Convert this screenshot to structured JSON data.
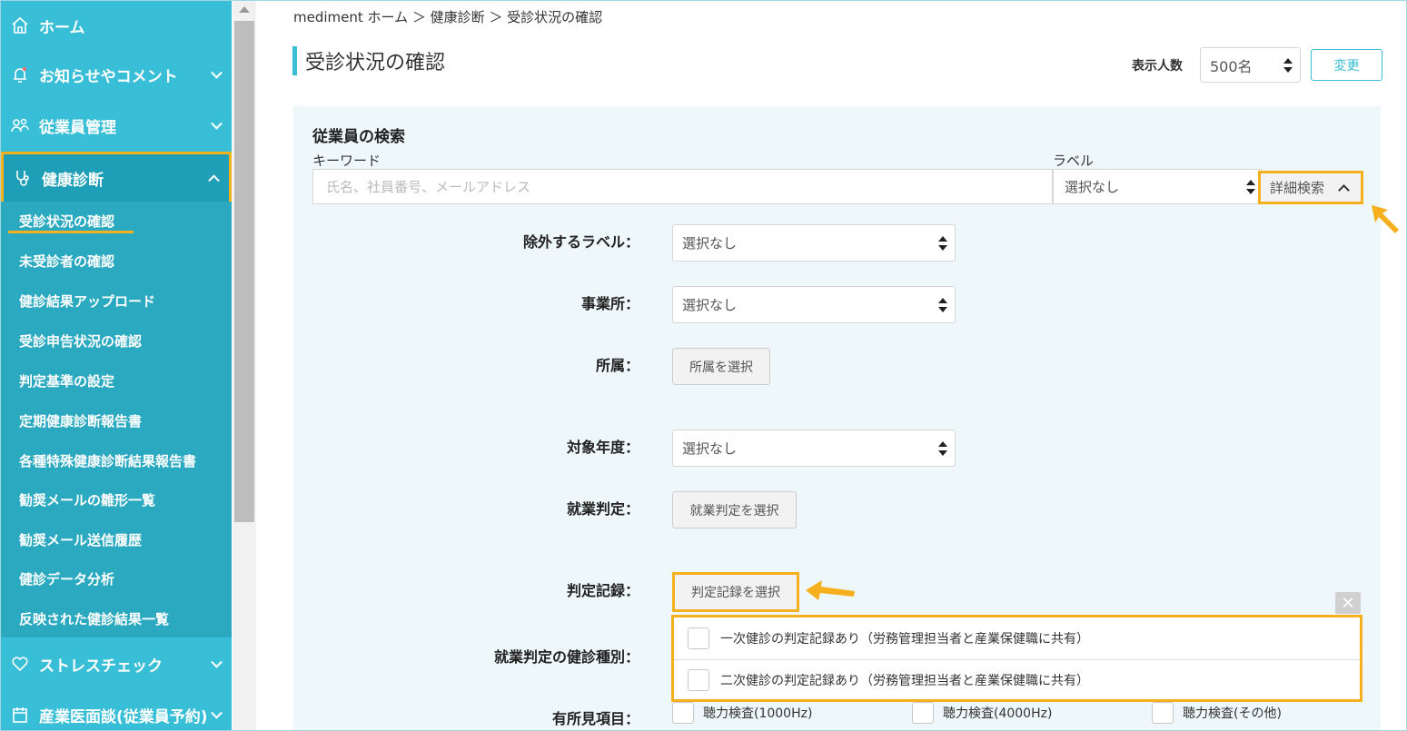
{
  "sidebar": {
    "home": "ホーム",
    "notices": "お知らせやコメント",
    "employees": "従業員管理",
    "health_check": "健康診断",
    "sub_items": [
      "受診状況の確認",
      "未受診者の確認",
      "健診結果アップロード",
      "受診申告状況の確認",
      "判定基準の設定",
      "定期健康診断報告書",
      "各種特殊健康診断結果報告書",
      "勧奨メールの雛形一覧",
      "勧奨メール送信履歴",
      "健診データ分析",
      "反映された健診結果一覧"
    ],
    "stress_check": "ストレスチェック",
    "interview": "産業医面談(従業員予約)"
  },
  "breadcrumb": "mediment ホーム ＞ 健康診断 ＞ 受診状況の確認",
  "page_title": "受診状況の確認",
  "display_count": {
    "label": "表示人数",
    "value": "500名",
    "button": "変更"
  },
  "search": {
    "title": "従業員の検索",
    "keyword_label": "キーワード",
    "keyword_placeholder": "氏名、社員番号、メールアドレス",
    "label_label": "ラベル",
    "label_value": "選択なし",
    "advanced_button": "詳細検索"
  },
  "filters": {
    "exclude_label": {
      "label": "除外するラベル：",
      "value": "選択なし"
    },
    "office": {
      "label": "事業所：",
      "value": "選択なし"
    },
    "department": {
      "label": "所属：",
      "button": "所属を選択"
    },
    "target_year": {
      "label": "対象年度：",
      "value": "選択なし"
    },
    "work_judgment": {
      "label": "就業判定：",
      "button": "就業判定を選択"
    },
    "judgment_record": {
      "label": "判定記録：",
      "button": "判定記録を選択"
    },
    "work_judgment_type": {
      "label": "就業判定の健診種別："
    },
    "findings": {
      "label": "有所見項目：",
      "options": [
        "聴力検査(1000Hz)",
        "聴力検査(4000Hz)",
        "聴力検査(その他)"
      ]
    }
  },
  "popup": {
    "close": "✕",
    "options": [
      "一次健診の判定記録あり（労務管理担当者と産業保健職に共有）",
      "二次健診の判定記録あり（労務管理担当者と産業保健職に共有）"
    ]
  },
  "colors": {
    "sidebar": "#38bfd7",
    "highlight": "#f6b01e",
    "panel": "#eef7f9"
  }
}
